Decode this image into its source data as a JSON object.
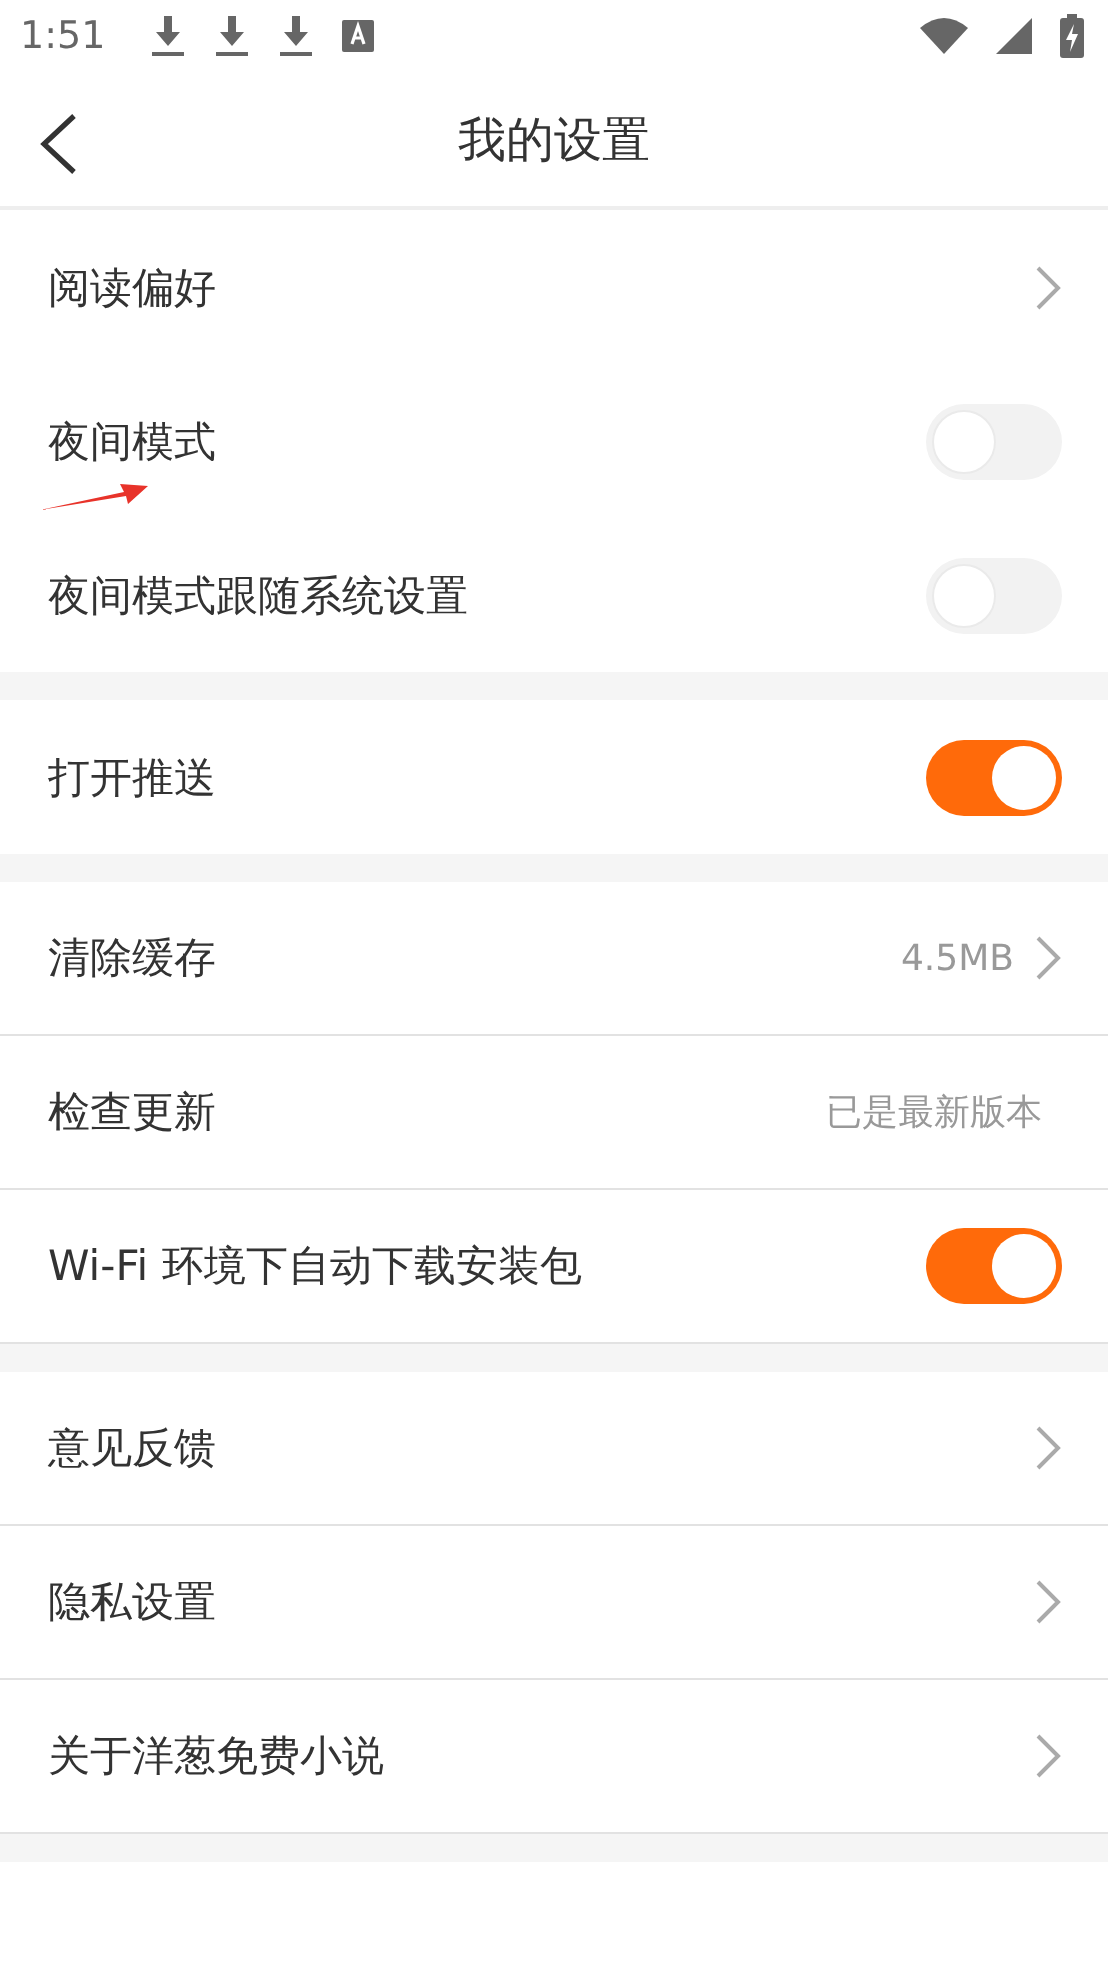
{
  "status_bar": {
    "time": "1:51"
  },
  "header": {
    "title": "我的设置"
  },
  "groups": [
    {
      "dividers": false,
      "rows": [
        {
          "kind": "link",
          "label": "阅读偏好"
        },
        {
          "kind": "toggle",
          "label": "夜间模式",
          "on": false
        },
        {
          "kind": "toggle",
          "label": "夜间模式跟随系统设置",
          "on": false
        }
      ]
    },
    {
      "dividers": false,
      "rows": [
        {
          "kind": "toggle",
          "label": "打开推送",
          "on": true
        }
      ]
    },
    {
      "dividers": true,
      "rows": [
        {
          "kind": "link",
          "label": "清除缓存",
          "value": "4.5MB"
        },
        {
          "kind": "value",
          "label": "检查更新",
          "value": "已是最新版本"
        },
        {
          "kind": "toggle",
          "label": "Wi-Fi 环境下自动下载安装包",
          "on": true
        }
      ]
    },
    {
      "dividers": true,
      "rows": [
        {
          "kind": "link",
          "label": "意见反馈"
        },
        {
          "kind": "link",
          "label": "隐私设置"
        },
        {
          "kind": "link",
          "label": "关于洋葱免费小说"
        }
      ]
    }
  ]
}
